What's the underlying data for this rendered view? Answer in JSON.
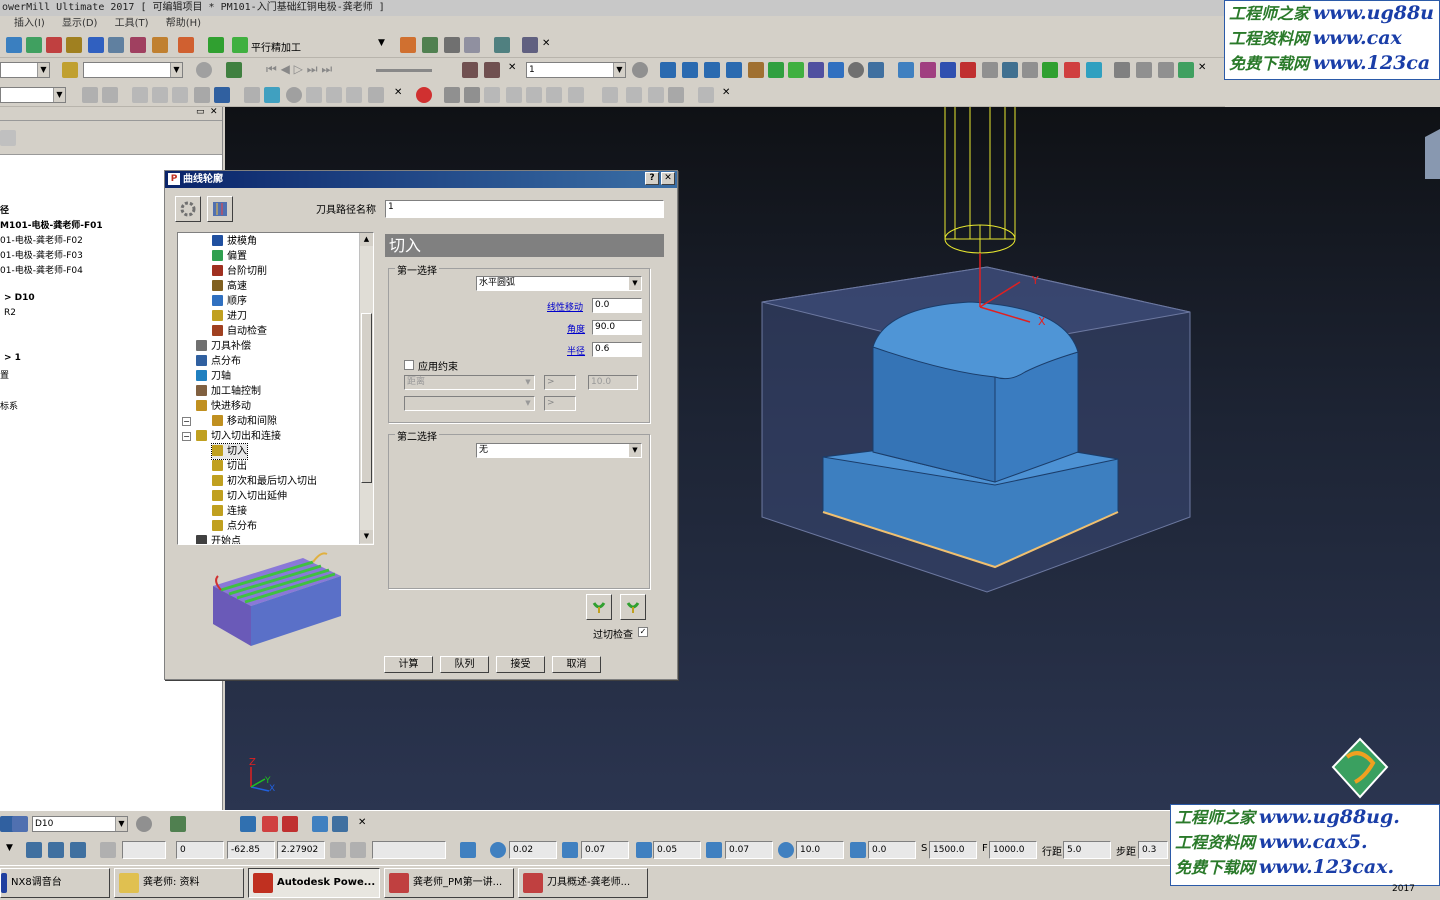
{
  "app": {
    "title": "owerMill Ultimate 2017   [ 可编辑项目 * PM101-入门基础红铜电极-龚老师 ]",
    "menu": [
      "插入(I)",
      "显示(D)",
      "工具(T)",
      "帮助(H)"
    ]
  },
  "toolbar": {
    "strategy_label": "平行精加工",
    "toolpath_combo": "1"
  },
  "explorer": {
    "items": [
      "径",
      "M101-电极-龚老师-F01",
      "01-电极-龚老师-F02",
      "01-电极-龚老师-F03",
      "01-电极-龚老师-F04",
      "> D10",
      "R2",
      "> 1",
      "置",
      "标系"
    ]
  },
  "dialog": {
    "title": "曲线轮廓",
    "help": "?",
    "close": "✕",
    "toolpath_name_label": "刀具路径名称",
    "toolpath_name_value": "1",
    "tree": [
      {
        "label": "拔模角",
        "level": 2,
        "color": "#2050a0"
      },
      {
        "label": "偏置",
        "level": 2,
        "color": "#30a050"
      },
      {
        "label": "台阶切削",
        "level": 2,
        "color": "#a03020"
      },
      {
        "label": "高速",
        "level": 2,
        "color": "#806020"
      },
      {
        "label": "顺序",
        "level": 2,
        "color": "#3070c0"
      },
      {
        "label": "进刀",
        "level": 2,
        "color": "#c0a020"
      },
      {
        "label": "自动检查",
        "level": 2,
        "color": "#a04020"
      },
      {
        "label": "刀具补偿",
        "level": 1,
        "color": "#707070"
      },
      {
        "label": "点分布",
        "level": 1,
        "color": "#3060a0"
      },
      {
        "label": "刀轴",
        "level": 1,
        "color": "#2080c0"
      },
      {
        "label": "加工轴控制",
        "level": 1,
        "color": "#806040"
      },
      {
        "label": "快进移动",
        "level": 1,
        "color": "#c09020"
      },
      {
        "label": "移动和间隙",
        "level": 2,
        "color": "#c09020"
      },
      {
        "label": "切入切出和连接",
        "level": 1,
        "color": "#c0a020"
      },
      {
        "label": "切入",
        "level": 2,
        "color": "#c0a020"
      },
      {
        "label": "切出",
        "level": 2,
        "color": "#c0a020"
      },
      {
        "label": "初次和最后切入切出",
        "level": 2,
        "color": "#c0a020"
      },
      {
        "label": "切入切出延伸",
        "level": 2,
        "color": "#c0a020"
      },
      {
        "label": "连接",
        "level": 2,
        "color": "#c0a020"
      },
      {
        "label": "点分布",
        "level": 2,
        "color": "#c0a020"
      },
      {
        "label": "开始点",
        "level": 1,
        "color": "#404040"
      }
    ],
    "section_title": "切入",
    "first_choice": {
      "label": "第一选择",
      "type": "水平圆弧",
      "linear_move_label": "线性移动",
      "linear_move": "0.0",
      "angle_label": "角度",
      "angle": "90.0",
      "radius_label": "半径",
      "radius": "0.6",
      "apply_constraint_label": "应用约束",
      "apply_constraint": false,
      "constraint_type": "距离",
      "constraint_value": "10.0",
      "constraint_op": ">",
      "constraint_op2": ">"
    },
    "second_choice": {
      "label": "第二选择",
      "type": "无"
    },
    "gouge_check_label": "过切检查",
    "gouge_check": true,
    "buttons": {
      "calculate": "计算",
      "queue": "队列",
      "accept": "接受",
      "cancel": "取消"
    }
  },
  "viewport": {
    "axis_x": "X",
    "axis_y": "Y",
    "triad_z": "Z",
    "triad_y": "Y",
    "triad_x": "X"
  },
  "status": {
    "tool_combo": "D10",
    "x": "0",
    "y": "-62.85",
    "z": "2.27902",
    "tol": "0.02",
    "thickness": "0.07",
    "axial": "0.05",
    "radial": "0.07",
    "dia": "10.0",
    "angle": "0.0",
    "spindle_label": "S",
    "spindle": "1500.0",
    "feed_label": "F",
    "feed": "1000.0",
    "stepover_label": "行距",
    "stepover": "5.0",
    "stepdown_label": "步距",
    "stepdown": "0.3"
  },
  "taskbar": [
    {
      "label": "NX8调音台"
    },
    {
      "label": "龚老师: 资料"
    },
    {
      "label": "Autodesk Powe..."
    },
    {
      "label": "龚老师_PM第一讲..."
    },
    {
      "label": "刀具概述-龚老师..."
    }
  ],
  "watermark": {
    "lines": [
      {
        "cn": "工程师之家",
        "url": "www.ug88u"
      },
      {
        "cn": "工程资料网",
        "url": "www.cax"
      },
      {
        "cn": "免费下载网",
        "url": "www.123ca"
      }
    ],
    "lines_bottom": [
      {
        "cn": "工程师之家",
        "url": "www.ug88ug."
      },
      {
        "cn": "工程资料网",
        "url": "www.cax5."
      },
      {
        "cn": "免费下载网",
        "url": "www.123cax."
      }
    ],
    "year": "2017"
  }
}
